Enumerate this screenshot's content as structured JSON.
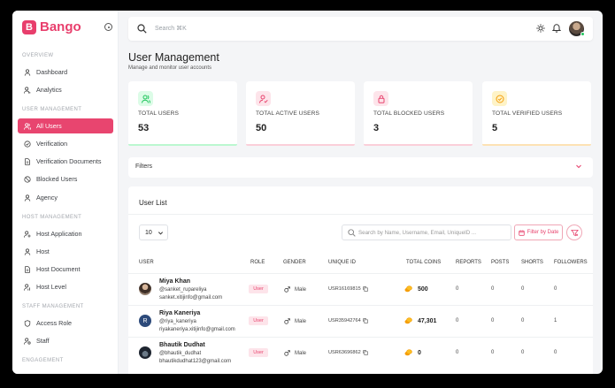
{
  "brand": {
    "name": "Bango",
    "accent": "#e8456f"
  },
  "sidebar": {
    "sections": [
      {
        "title": "OVERVIEW",
        "items": [
          {
            "label": "Dashboard",
            "icon": "user-icon"
          },
          {
            "label": "Analytics",
            "icon": "analytics-icon"
          }
        ]
      },
      {
        "title": "USER MANAGEMENT",
        "items": [
          {
            "label": "All Users",
            "icon": "users-icon",
            "active": true
          },
          {
            "label": "Verification",
            "icon": "check-circle-icon"
          },
          {
            "label": "Verification Documents",
            "icon": "document-icon"
          },
          {
            "label": "Blocked Users",
            "icon": "block-icon"
          },
          {
            "label": "Agency",
            "icon": "agency-icon"
          }
        ]
      },
      {
        "title": "HOST MANAGEMENT",
        "items": [
          {
            "label": "Host Application",
            "icon": "user-add-icon"
          },
          {
            "label": "Host",
            "icon": "user-icon"
          },
          {
            "label": "Host Document",
            "icon": "document-icon"
          },
          {
            "label": "Host Level",
            "icon": "user-level-icon"
          }
        ]
      },
      {
        "title": "STAFF MANAGEMENT",
        "items": [
          {
            "label": "Access Role",
            "icon": "shield-icon"
          },
          {
            "label": "Staff",
            "icon": "staff-icon"
          }
        ]
      },
      {
        "title": "ENGAGEMENT",
        "items": []
      }
    ]
  },
  "topbar": {
    "search_placeholder": "Search ⌘K"
  },
  "page": {
    "title": "User Management",
    "subtitle": "Manage and monitor user accounts"
  },
  "cards": [
    {
      "label": "TOTAL USERS",
      "value": "53",
      "icon": "users-icon",
      "color": "#22c55e",
      "bg": "#dcfce7"
    },
    {
      "label": "TOTAL ACTIVE USERS",
      "value": "50",
      "icon": "user-active-icon",
      "color": "#e8456f",
      "bg": "#fde4ea"
    },
    {
      "label": "TOTAL BLOCKED USERS",
      "value": "3",
      "icon": "lock-icon",
      "color": "#e8456f",
      "bg": "#fde4ea"
    },
    {
      "label": "TOTAL VERIFIED USERS",
      "value": "5",
      "icon": "verified-icon",
      "color": "#f59e0b",
      "bg": "#fef3c7"
    }
  ],
  "filters": {
    "label": "Filters"
  },
  "user_list": {
    "title": "User List",
    "page_size": "10",
    "search_placeholder": "Search by Name, Username, Email, UniqueID ...",
    "filter_by_date": "Filter by Date",
    "columns": [
      "USER",
      "ROLE",
      "GENDER",
      "UNIQUE ID",
      "TOTAL COINS",
      "REPORTS",
      "POSTS",
      "SHORTS",
      "FOLLOWERS"
    ],
    "rows": [
      {
        "name": "Miya Khan",
        "username": "@sanket_rupareliya",
        "email": "sanket.xitijinfo@gmail.com",
        "role": "User",
        "gender": "Male",
        "unique_id": "USR16169815",
        "coins": "500",
        "reports": "0",
        "posts": "0",
        "shorts": "0",
        "followers": "0",
        "avatar": "photo"
      },
      {
        "name": "Riya Kaneriya",
        "username": "@riya_kaneriya",
        "email": "riyakaneriya.xitijinfo@gmail.com",
        "role": "User",
        "gender": "Male",
        "unique_id": "USR35942764",
        "coins": "47,301",
        "reports": "0",
        "posts": "0",
        "shorts": "0",
        "followers": "1",
        "avatar": "R"
      },
      {
        "name": "Bhautik Dudhat",
        "username": "@bhautik_dudhat",
        "email": "bhautikdudhat123@gmail.com",
        "role": "User",
        "gender": "Male",
        "unique_id": "USR63696862",
        "coins": "0",
        "reports": "0",
        "posts": "0",
        "shorts": "0",
        "followers": "0",
        "avatar": "photo"
      }
    ]
  }
}
